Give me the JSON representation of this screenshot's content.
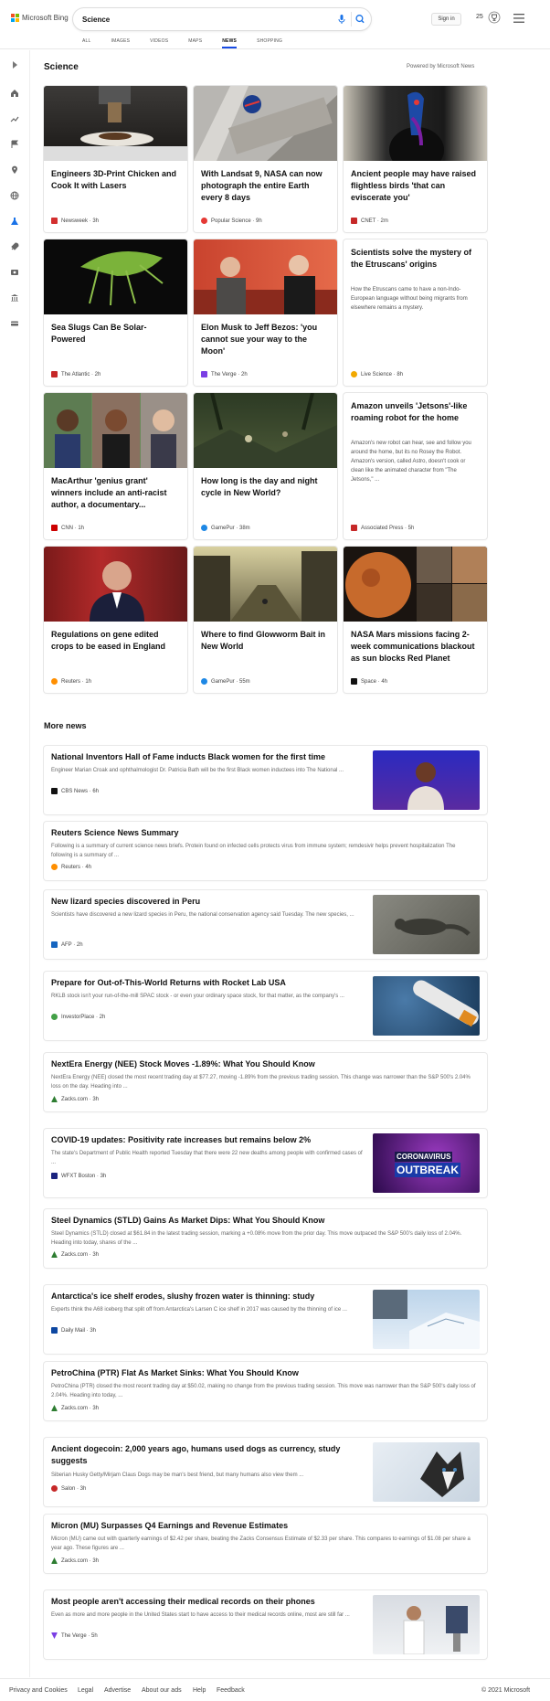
{
  "brand": {
    "name": "Microsoft Bing"
  },
  "search": {
    "query": "Science"
  },
  "header": {
    "signin": "Sign in",
    "points": "25"
  },
  "tabs": [
    "ALL",
    "IMAGES",
    "VIDEOS",
    "MAPS",
    "NEWS",
    "SHOPPING"
  ],
  "active_tab": "NEWS",
  "section": {
    "title": "Science",
    "powered": "Powered by Microsoft News"
  },
  "cards": [
    {
      "title": "Engineers 3D-Print Chicken and Cook It with Lasers",
      "source": "Newsweek · 3h",
      "color": "#d32f2f",
      "image": "lab-scene"
    },
    {
      "title": "With Landsat 9, NASA can now photograph the entire Earth every 8 days",
      "source": "Popular Science · 9h",
      "color": "#e53935",
      "image": "satellite-hall"
    },
    {
      "title": "Ancient people may have raised flightless birds 'that can eviscerate you'",
      "source": "CNET · 2m",
      "color": "#c62828",
      "image": "cassowary"
    },
    {
      "title": "Sea Slugs Can Be Solar-Powered",
      "source": "The Atlantic · 2h",
      "color": "#c62828",
      "image": "sea-slug"
    },
    {
      "title": "Elon Musk to Jeff Bezos: 'you cannot sue your way to the Moon'",
      "source": "The Verge · 2h",
      "color": "#7b3fe4",
      "image": "elon-musk"
    },
    {
      "title": "Scientists solve the mystery of the Etruscans' origins",
      "snippet": "How the Etruscans came to have a non-Indo-European language without being migrants from elsewhere remains a mystery.",
      "source": "Live Science · 8h",
      "color": "#f2a900"
    },
    {
      "title": "MacArthur 'genius grant' winners include an anti-racist author, a documentary...",
      "source": "CNN · 1h",
      "color": "#cc0000",
      "image": "portraits"
    },
    {
      "title": "How long is the day and night cycle in New World?",
      "source": "GamePur · 38m",
      "color": "#1e88e5",
      "image": "game-scene"
    },
    {
      "title": "Amazon unveils 'Jetsons'-like roaming robot for the home",
      "snippet": "Amazon's new robot can hear, see and follow you around the home, but its no Rosey the Robot. Amazon's version, called Astro, doesn't cook or clean like the animated character from \"The Jetsons,\" ...",
      "source": "Associated Press · 5h",
      "color": "#c62828"
    },
    {
      "title": "Regulations on gene edited crops to be eased in England",
      "source": "Reuters · 1h",
      "color": "#ff8f00",
      "image": "politician"
    },
    {
      "title": "Where to find Glowworm Bait in New World",
      "source": "GamePur · 55m",
      "color": "#1e88e5",
      "image": "forest-town"
    },
    {
      "title": "NASA Mars missions facing 2-week communications blackout as sun blocks Red Planet",
      "source": "Space · 4h",
      "color": "#111111",
      "image": "mars-collage"
    }
  ],
  "more": {
    "title": "More news",
    "items": [
      {
        "title": "National Inventors Hall of Fame inducts Black women for the first time",
        "snippet": "Engineer Marian Croak and ophthalmologist Dr. Patricia Bath will be the first Black women inductees into The National ...",
        "source": "CBS News · 6h",
        "color": "#111111",
        "image": "inductee"
      },
      {
        "title": "Reuters Science News Summary",
        "snippet": "Following is a summary of current science news briefs. Protein found on infected cells protects virus from immune system; remdesivir helps prevent hospitalization The following is a summary of ...",
        "source": "Reuters · 4h",
        "color": "#ff8f00"
      },
      {
        "title": "New lizard species discovered in Peru",
        "snippet": "Scientists have discovered a new lizard species in Peru, the national conservation agency said Tuesday. The new species, ...",
        "source": "AFP · 2h",
        "color": "#1565c0",
        "image": "lizard"
      },
      {
        "title": "Prepare for Out-of-This-World Returns with Rocket Lab USA",
        "snippet": "RKLB stock isn't your run-of-the-mill SPAC stock - or even your ordinary space stock, for that matter, as the company's ...",
        "source": "InvestorPlace · 2h",
        "color": "#43a047",
        "image": "rocket"
      },
      {
        "title": "NextEra Energy (NEE) Stock Moves -1.89%: What You Should Know",
        "snippet": "NextEra Energy (NEE) closed the most recent trading day at $77.27, moving -1.89% from the previous trading session. This change was narrower than the S&P 500's 2.04% loss on the day. Heading into ...",
        "source": "Zacks.com · 3h",
        "color": "#2e7d32"
      },
      {
        "title": "COVID-19 updates: Positivity rate increases but remains below 2%",
        "snippet": "The state's Department of Public Health reported Tuesday that there were 22 new deaths among people with confirmed cases of ...",
        "source": "WFXT Boston · 3h",
        "color": "#1a237e",
        "image": "outbreak",
        "overlay": [
          "CORONAVIRUS",
          "OUTBREAK"
        ]
      },
      {
        "title": "Steel Dynamics (STLD) Gains As Market Dips: What You Should Know",
        "snippet": "Steel Dynamics (STLD) closed at $61.84 in the latest trading session, marking a +0.08% move from the prior day. This move outpaced the S&P 500's daily loss of 2.04%. Heading into today, shares of the ...",
        "source": "Zacks.com · 3h",
        "color": "#2e7d32"
      },
      {
        "title": "Antarctica's ice shelf erodes, slushy frozen water is thinning: study",
        "snippet": "Experts think the A68 iceberg that split off from Antarctica's Larsen C ice shelf in 2017 was caused by the thinning of ice ...",
        "source": "Daily Mail · 3h",
        "color": "#0d47a1",
        "image": "iceshelf"
      },
      {
        "title": "PetroChina (PTR) Flat As Market Sinks: What You Should Know",
        "snippet": "PetroChina (PTR) closed the most recent trading day at $50.02, making no change from the previous trading session. This move was narrower than the S&P 500's daily loss of 2.04%. Heading into today, ...",
        "source": "Zacks.com · 3h",
        "color": "#2e7d32"
      },
      {
        "title": "Ancient dogecoin: 2,000 years ago, humans used dogs as currency, study suggests",
        "snippet": "Siberian Husky Getty/Mirjam Claus Dogs may be man's best friend, but many humans also view them ...",
        "source": "Salon · 3h",
        "color": "#c62828",
        "image": "husky"
      },
      {
        "title": "Micron (MU) Surpasses Q4 Earnings and Revenue Estimates",
        "snippet": "Micron (MU) came out with quarterly earnings of $2.42 per share, beating the Zacks Consensus Estimate of $2.33 per share. This compares to earnings of $1.08 per share a year ago. These figures are ...",
        "source": "Zacks.com · 3h",
        "color": "#2e7d32"
      },
      {
        "title": "Most people aren't accessing their medical records on their phones",
        "snippet": "Even as more and more people in the United States start to have access to their medical records online, most are still far ...",
        "source": "The Verge · 5h",
        "color": "#7b3fe4",
        "image": "doctor"
      }
    ]
  },
  "footer": {
    "links": [
      "Privacy and Cookies",
      "Legal",
      "Advertise",
      "About our ads",
      "Help",
      "Feedback"
    ],
    "copyright": "© 2021 Microsoft"
  }
}
